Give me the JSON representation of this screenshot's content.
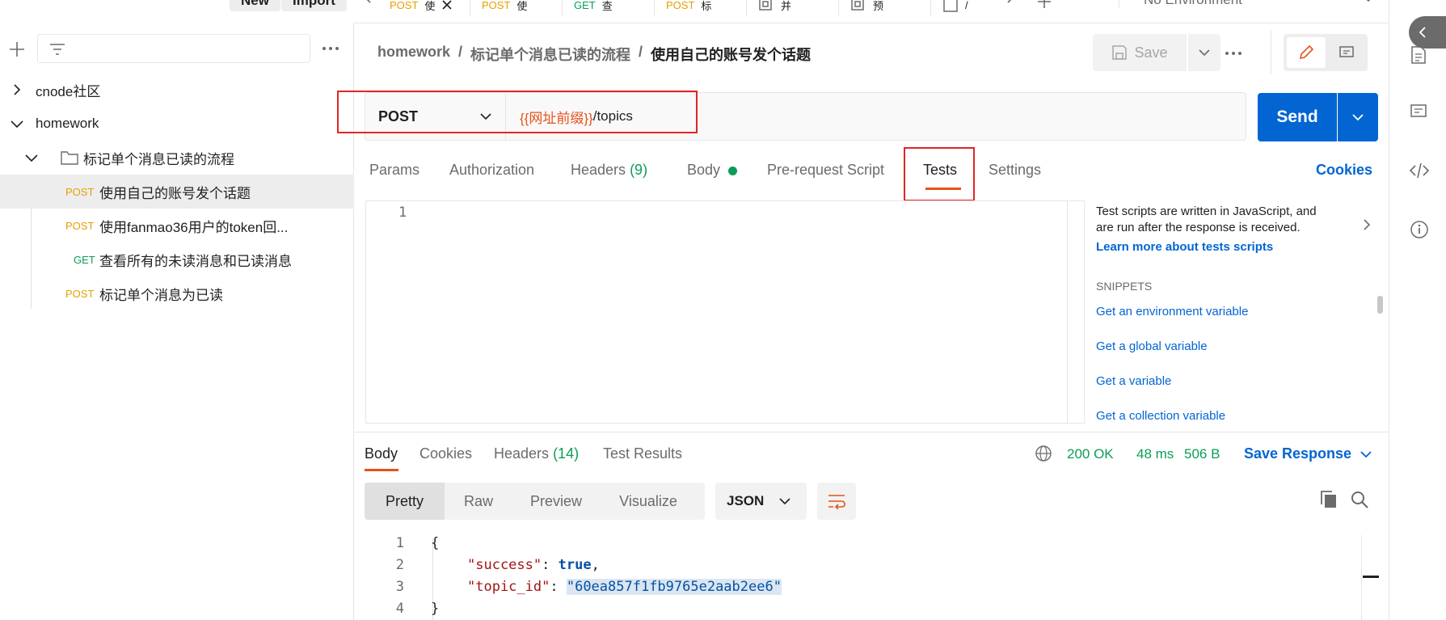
{
  "top": {
    "new_label": "New",
    "import_label": "Import",
    "tabs": [
      {
        "method": "POST",
        "label": "使"
      },
      {
        "method": "POST",
        "label": "使"
      },
      {
        "method": "GET",
        "label": "查"
      },
      {
        "method": "POST",
        "label": "标"
      },
      {
        "method": "",
        "label": "并"
      },
      {
        "method": "",
        "label": "预"
      },
      {
        "method": "",
        "label": "/"
      }
    ],
    "environment": "No Environment"
  },
  "sidebar": {
    "search_placeholder": "",
    "collections": [
      {
        "label": "cnode社区",
        "expanded": false
      },
      {
        "label": "homework",
        "expanded": true
      }
    ],
    "folder": {
      "label": "标记单个消息已读的流程"
    },
    "requests": [
      {
        "method": "POST",
        "label": "使用自己的账号发个话题"
      },
      {
        "method": "POST",
        "label": "使用fanmao36用户的token回..."
      },
      {
        "method": "GET",
        "label": "查看所有的未读消息和已读消息"
      },
      {
        "method": "POST",
        "label": "标记单个消息为已读"
      }
    ]
  },
  "breadcrumb": {
    "collection": "homework",
    "sep1": "/",
    "folder": "标记单个消息已读的流程",
    "sep2": "/",
    "request": "使用自己的账号发个话题"
  },
  "actions": {
    "save_label": "Save",
    "send_label": "Send"
  },
  "request": {
    "method": "POST",
    "url_var": "{{网址前缀}}",
    "url_path": "/topics",
    "tabs": {
      "params": "Params",
      "authorization": "Authorization",
      "headers": "Headers",
      "headers_count": "(9)",
      "body": "Body",
      "prerequest": "Pre-request Script",
      "tests": "Tests",
      "settings": "Settings",
      "cookies": "Cookies"
    },
    "editor_line": "1"
  },
  "help": {
    "line1": "Test scripts are written in JavaScript, and",
    "line2": "are run after the response is received.",
    "learn_more": "Learn more about tests scripts",
    "snippets_title": "SNIPPETS",
    "snippets": [
      "Get an environment variable",
      "Get a global variable",
      "Get a variable",
      "Get a collection variable"
    ]
  },
  "response": {
    "tabs": {
      "body": "Body",
      "cookies": "Cookies",
      "headers": "Headers",
      "headers_count": "(14)",
      "test_results": "Test Results"
    },
    "status": "200 OK",
    "time": "48 ms",
    "size": "506 B",
    "save_response": "Save Response",
    "views": [
      "Pretty",
      "Raw",
      "Preview",
      "Visualize"
    ],
    "format": "JSON",
    "lines": [
      {
        "n": "1",
        "text": "{"
      },
      {
        "n": "2",
        "key": "\"success\"",
        "colon": ": ",
        "value": "true",
        "tail": ","
      },
      {
        "n": "3",
        "key": "\"topic_id\"",
        "colon": ": ",
        "value": "\"60ea857f1fb9765e2aab2ee6\"",
        "tail": ""
      },
      {
        "n": "4",
        "text": "}"
      }
    ]
  },
  "colors": {
    "accent": "#0265d2",
    "orange": "#e5531a",
    "highlight": "#e12525",
    "status": "#0c9d58"
  }
}
